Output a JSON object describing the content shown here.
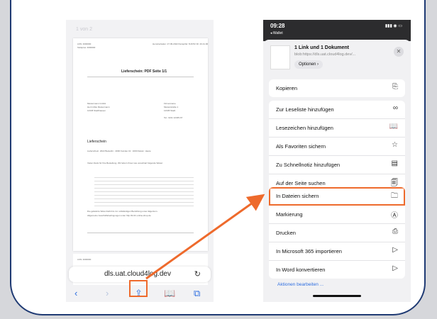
{
  "left_phone": {
    "page_indicator": "1 von 2",
    "doc_title": "Lieferschein: PDF Seite 1/1",
    "doc_heading": "Lieferschein",
    "address_bar": "dls.uat.cloud4log.dev",
    "toolbar": {
      "back_icon": "chevron-left",
      "forward_icon": "chevron-right",
      "share_icon": "share",
      "bookmarks_icon": "book",
      "tabs_icon": "tabs"
    }
  },
  "right_phone": {
    "time": "09:28",
    "back_label": "◂ Wallet",
    "sheet": {
      "title": "1 Link und 1 Dokument",
      "subtitle": "blob:https://dls.uat.cloud4log.dev/...",
      "options_label": "Optionen ›",
      "close_glyph": "✕"
    },
    "group1": [
      {
        "label": "Kopieren",
        "icon": "⎘"
      }
    ],
    "group2": [
      {
        "label": "Zur Leseliste hinzufügen",
        "icon": "∞"
      },
      {
        "label": "Lesezeichen hinzufügen",
        "icon": "📖"
      },
      {
        "label": "Als Favoriten sichern",
        "icon": "☆"
      },
      {
        "label": "Zu Schnellnotiz hinzufügen",
        "icon": "▤"
      },
      {
        "label": "Auf der Seite suchen",
        "icon": "🗐"
      }
    ],
    "group3": [
      {
        "label": "In Dateien sichern",
        "icon": "🗀"
      },
      {
        "label": "Markierung",
        "icon": "Ⓐ"
      },
      {
        "label": "Drucken",
        "icon": "⎙"
      },
      {
        "label": "In Microsoft 365 importieren",
        "icon": "▷"
      },
      {
        "label": "In Word konvertieren",
        "icon": "▷"
      }
    ],
    "edit_actions": "Aktionen bearbeiten ..."
  },
  "colors": {
    "accent": "#ee6a2c",
    "frame": "#1f3a73",
    "link": "#2f6fe0"
  }
}
